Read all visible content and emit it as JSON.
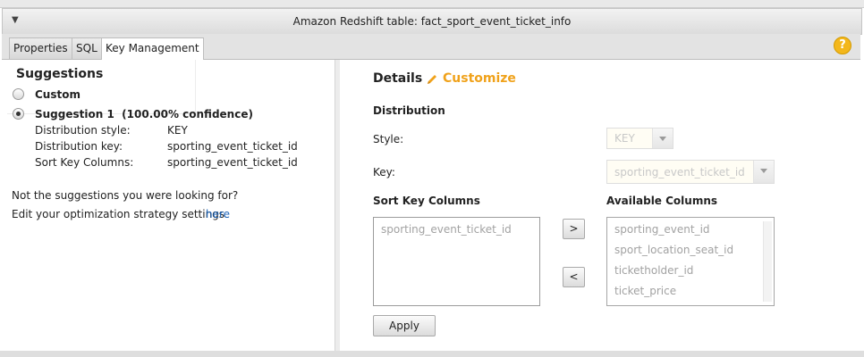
{
  "window": {
    "title": "Amazon Redshift table: fact_sport_event_ticket_info"
  },
  "tabs": [
    {
      "label": "Properties"
    },
    {
      "label": "SQL"
    },
    {
      "label": "Key Management",
      "active": true
    }
  ],
  "help_icon": {
    "glyph": "?",
    "icon": "help-icon",
    "color": "#f3b71b"
  },
  "suggestions": {
    "title": "Suggestions",
    "options": [
      {
        "label": "Custom",
        "selected": false
      },
      {
        "label": "Suggestion 1  (100.00% confidence)",
        "selected": true
      }
    ],
    "details": [
      {
        "key": "Distribution style:",
        "value": "KEY"
      },
      {
        "key": "Distribution key:",
        "value": "sporting_event_ticket_id"
      },
      {
        "key": "Sort Key Columns:",
        "value": "sporting_event_ticket_id"
      }
    ],
    "footer_line1": "Not the suggestions you were looking for?",
    "footer_line2": "Edit your optimization strategy settings",
    "footer_link": "here"
  },
  "details": {
    "title": "Details",
    "customize_label": "Customize",
    "accent_color": "#f0a21b",
    "distribution_label": "Distribution",
    "style_label": "Style:",
    "style_value": "KEY",
    "key_label": "Key:",
    "key_value": "sporting_event_ticket_id",
    "sort_key_label": "Sort Key Columns",
    "sort_key_items": [
      "sporting_event_ticket_id"
    ],
    "available_label": "Available Columns",
    "available_items": [
      "sporting_event_id",
      "sport_location_seat_id",
      "ticketholder_id",
      "ticket_price"
    ],
    "move_right": ">",
    "move_left": "<",
    "apply_label": "Apply"
  }
}
